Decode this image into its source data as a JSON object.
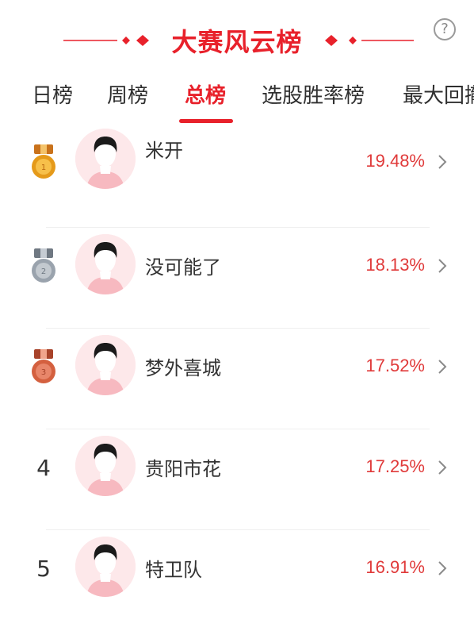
{
  "header": {
    "title": "大赛风云榜",
    "help_icon": "question-circle-icon"
  },
  "tabs": [
    {
      "label": "日榜",
      "active": false
    },
    {
      "label": "周榜",
      "active": false
    },
    {
      "label": "总榜",
      "active": true
    },
    {
      "label": "选股胜率榜",
      "active": false
    },
    {
      "label": "最大回撤",
      "active": false
    }
  ],
  "ranking": [
    {
      "rank": "1",
      "medal": "gold-medal-icon",
      "name": "米开",
      "value": "19.48%"
    },
    {
      "rank": "2",
      "medal": "silver-medal-icon",
      "name": "没可能了",
      "value": "18.13%"
    },
    {
      "rank": "3",
      "medal": "bronze-medal-icon",
      "name": "梦外喜城",
      "value": "17.52%"
    },
    {
      "rank": "4",
      "medal": "",
      "name": "贵阳市花",
      "value": "17.25%"
    },
    {
      "rank": "5",
      "medal": "",
      "name": "特卫队",
      "value": "16.91%"
    }
  ],
  "colors": {
    "accent": "#e8212b",
    "value": "#e03a3a",
    "gold": "#e59a1a",
    "silver": "#9aa3ad",
    "bronze": "#d4603f"
  }
}
